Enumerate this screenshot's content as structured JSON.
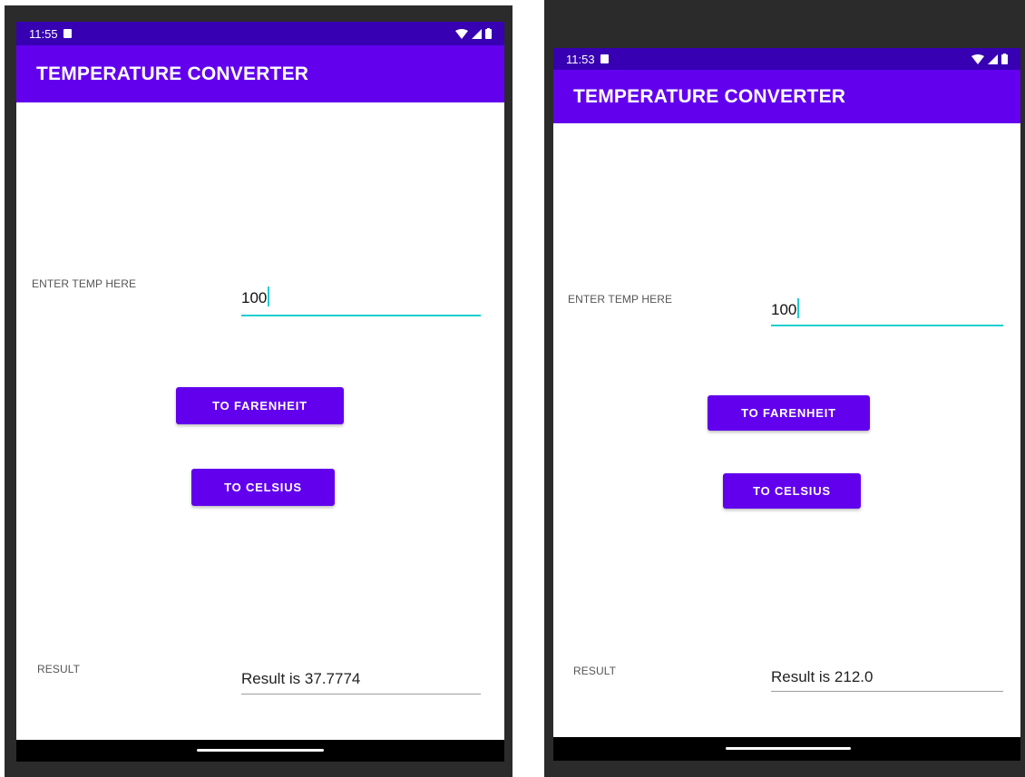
{
  "colors": {
    "primary": "#6200EE",
    "status_bar": "#3700B3",
    "accent": "#1ECFD0",
    "result_underline": "#9E9E9E"
  },
  "icons": [
    "sd-card-icon",
    "wifi-icon",
    "signal-icon",
    "battery-icon"
  ],
  "screens": [
    {
      "status_time": "11:55",
      "app_title": "TEMPERATURE CONVERTER",
      "temp_label": "ENTER TEMP HERE",
      "temp_value": "100",
      "to_fahrenheit_label": "TO FARENHEIT",
      "to_celsius_label": "TO CELSIUS",
      "result_label": "RESULT",
      "result_value": "Result is 37.7774"
    },
    {
      "status_time": "11:53",
      "app_title": "TEMPERATURE CONVERTER",
      "temp_label": "ENTER TEMP HERE",
      "temp_value": "100",
      "to_fahrenheit_label": "TO FARENHEIT",
      "to_celsius_label": "TO CELSIUS",
      "result_label": "RESULT",
      "result_value": "Result is 212.0"
    }
  ]
}
